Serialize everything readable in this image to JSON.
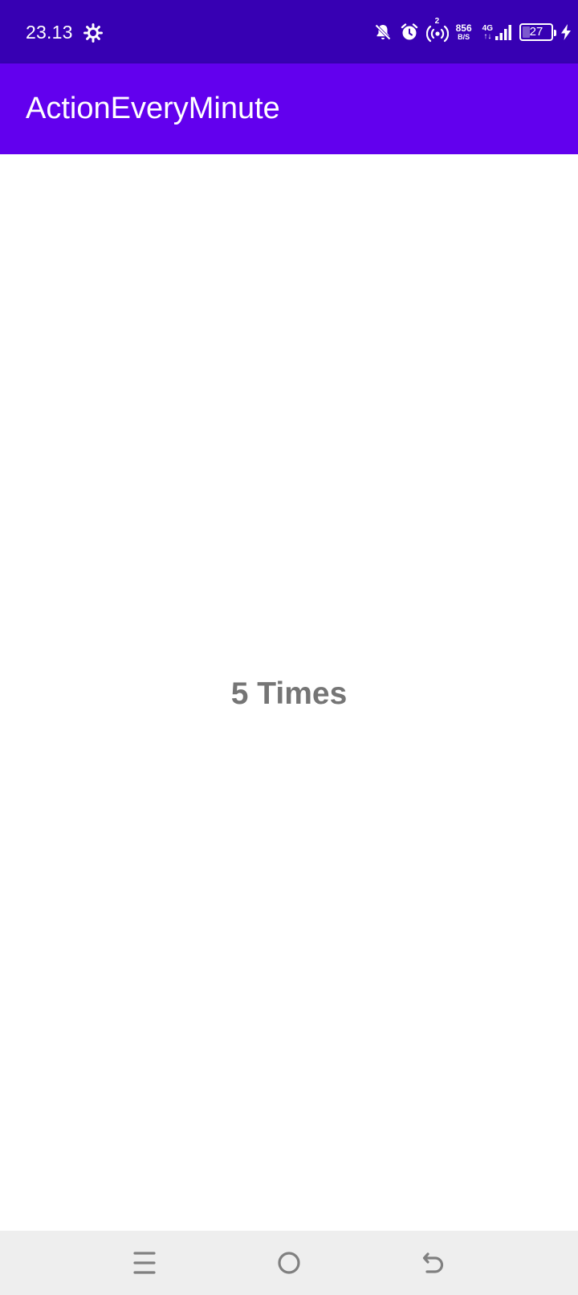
{
  "status_bar": {
    "time": "23.13",
    "net_speed_value": "856",
    "net_speed_unit": "B/S",
    "network_type": "4G",
    "network_arrows": "↑↓",
    "hotspot_count": "2",
    "battery_level": "27",
    "battery_fraction": 0.27,
    "icons": [
      "gear-icon",
      "notification-off-icon",
      "alarm-icon",
      "hotspot-icon",
      "signal-icon",
      "battery-icon",
      "charging-icon"
    ]
  },
  "app_bar": {
    "title": "ActionEveryMinute"
  },
  "main": {
    "counter_text": "5 Times"
  },
  "nav_bar": {
    "icons": [
      "menu-icon",
      "home-icon",
      "back-icon"
    ]
  },
  "colors": {
    "status_bar": "#3700b3",
    "app_bar": "#6200ee",
    "counter_text": "#757575",
    "nav_bar": "#eeeeee",
    "nav_icon": "#808080"
  }
}
